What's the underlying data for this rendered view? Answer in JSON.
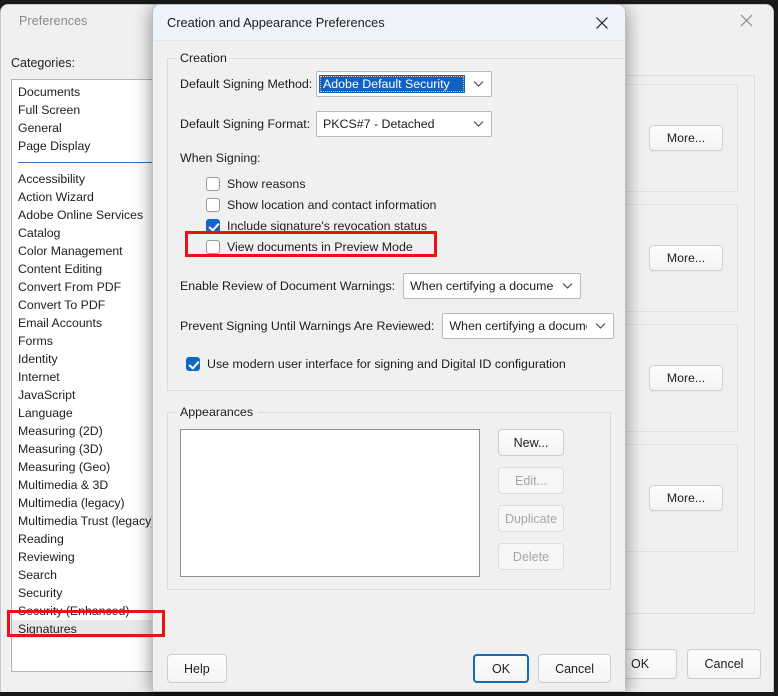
{
  "background_window": {
    "title": "Preferences",
    "close_icon": "close-icon",
    "categories_label": "Categories:",
    "categories_group1": [
      "Documents",
      "Full Screen",
      "General",
      "Page Display"
    ],
    "categories_group2": [
      "Accessibility",
      "Action Wizard",
      "Adobe Online Services",
      "Catalog",
      "Color Management",
      "Content Editing",
      "Convert From PDF",
      "Convert To PDF",
      "Email Accounts",
      "Forms",
      "Identity",
      "Internet",
      "JavaScript",
      "Language",
      "Measuring (2D)",
      "Measuring (3D)",
      "Measuring (Geo)",
      "Multimedia & 3D",
      "Multimedia (legacy)",
      "Multimedia Trust (legacy)",
      "Reading",
      "Reviewing",
      "Search",
      "Security",
      "Security (Enhanced)",
      "Signatures"
    ],
    "selected_category": "Signatures",
    "more_buttons": [
      "More...",
      "More...",
      "More...",
      "More..."
    ],
    "footer": {
      "ok_label": "OK",
      "cancel_label": "Cancel"
    }
  },
  "dialog": {
    "title": "Creation and Appearance Preferences",
    "close_icon": "close-icon",
    "creation": {
      "legend": "Creation",
      "default_signing_method": {
        "label": "Default Signing Method:",
        "value": "Adobe Default Security",
        "selected": true
      },
      "default_signing_format": {
        "label": "Default Signing Format:",
        "value": "PKCS#7 - Detached"
      },
      "when_signing_label": "When Signing:",
      "checkboxes": [
        {
          "label": "Show reasons",
          "checked": false
        },
        {
          "label": "Show location and contact information",
          "checked": false
        },
        {
          "label": "Include signature's revocation status",
          "checked": true,
          "highlighted": true
        },
        {
          "label": "View documents in Preview Mode",
          "checked": false
        }
      ],
      "enable_review": {
        "label": "Enable Review of Document Warnings:",
        "value": "When certifying a document"
      },
      "prevent_signing": {
        "label": "Prevent Signing Until Warnings Are Reviewed:",
        "value": "When certifying a document"
      },
      "modern_ui": {
        "label": "Use modern user interface for signing and Digital ID configuration",
        "checked": true
      }
    },
    "appearances": {
      "legend": "Appearances",
      "list_items": [],
      "buttons": [
        {
          "label": "New...",
          "enabled": true
        },
        {
          "label": "Edit...",
          "enabled": false
        },
        {
          "label": "Duplicate",
          "enabled": false
        },
        {
          "label": "Delete",
          "enabled": false
        }
      ]
    },
    "footer": {
      "help_label": "Help",
      "ok_label": "OK",
      "cancel_label": "Cancel"
    }
  },
  "annotations": {
    "accent_color": "#ee1111",
    "boxes": [
      "signatures-category",
      "include-revocation-status-checkbox"
    ]
  },
  "colors": {
    "dialog_titlebar": "#eef4fa",
    "window_face": "#f0f0f0",
    "selection_blue": "#0f62c4",
    "checkbox_blue": "#1068c4",
    "focus_blue": "#0f6cbd",
    "separator_blue": "#2f74b5",
    "annotation_red": "#ee1111"
  }
}
